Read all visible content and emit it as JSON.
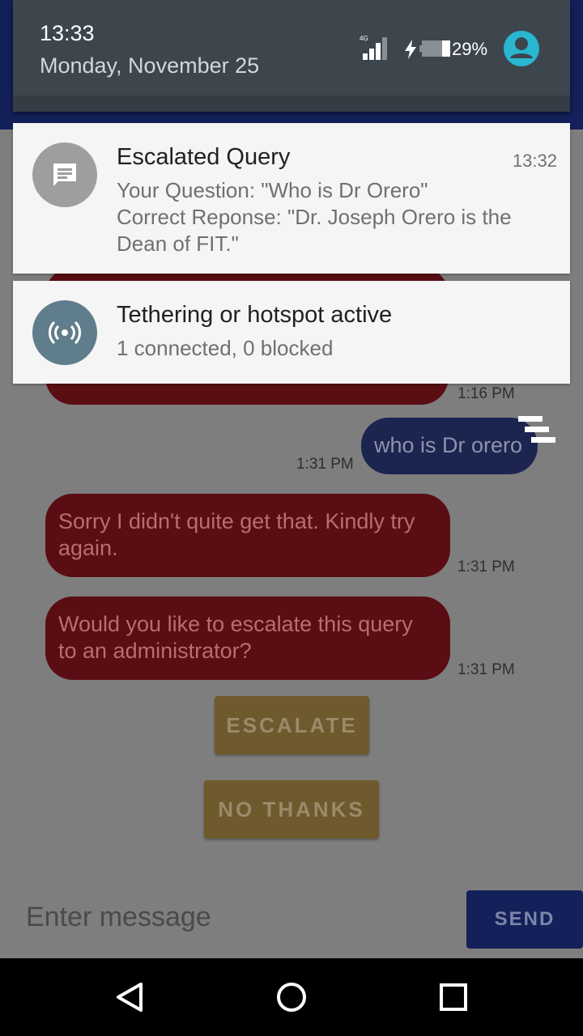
{
  "status_bar": {
    "time": "13:33",
    "date": "Monday, November 25",
    "network_type": "4G",
    "battery_percent": "29%",
    "icons": [
      "signal-icon",
      "charging-icon",
      "battery-icon",
      "account-icon"
    ]
  },
  "notifications": [
    {
      "icon": "message-icon",
      "title": "Escalated Query",
      "time": "13:32",
      "lines": [
        "Your Question: \"Who is Dr Orero\"",
        "Correct Reponse: \"Dr. Joseph Orero is the",
        "Dean of FIT.\""
      ]
    },
    {
      "icon": "hotspot-icon",
      "title": "Tethering or hotspot active",
      "lines": [
        "1 connected, 0 blocked"
      ]
    }
  ],
  "chat": {
    "messages": [
      {
        "sender": "bot",
        "time": "1:16 PM"
      },
      {
        "sender": "user",
        "text": "who is Dr orero",
        "time": "1:31 PM"
      },
      {
        "sender": "bot",
        "lines": [
          "Sorry I didn't quite get that. Kindly try",
          "again."
        ],
        "time": "1:31 PM"
      },
      {
        "sender": "bot",
        "lines": [
          "Would you like to escalate this query",
          "to an administrator?"
        ],
        "time": "1:31 PM"
      }
    ],
    "escalate_label": "ESCALATE",
    "no_thanks_label": "NO THANKS"
  },
  "input": {
    "placeholder": "Enter message",
    "send_label": "SEND"
  },
  "colors": {
    "bot_bubble": "#5a0d13",
    "user_bubble": "#1b2550",
    "action_button": "#6e5a2c",
    "app_primary": "#13205a",
    "avatar": "#29b6d0"
  },
  "nav": [
    "back-icon",
    "home-icon",
    "recents-icon"
  ]
}
